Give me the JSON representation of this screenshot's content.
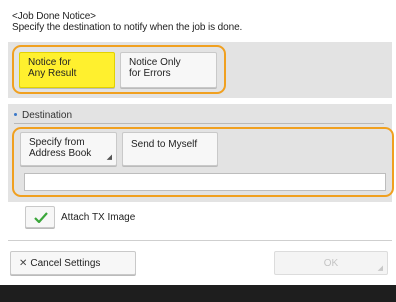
{
  "header": {
    "title": "<Job Done Notice>",
    "description": "Specify the destination to notify when the job is done."
  },
  "notice_options": {
    "any_result_line1": "Notice for",
    "any_result_line2": "Any Result",
    "errors_only_line1": "Notice Only",
    "errors_only_line2": "for Errors",
    "selected": "any_result"
  },
  "destination": {
    "label": "Destination",
    "address_book_line1": "Specify from",
    "address_book_line2": "Address Book",
    "send_to_myself": "Send to Myself",
    "input_value": ""
  },
  "attach": {
    "label": "Attach TX Image",
    "checked": true
  },
  "footer": {
    "cancel_label": "Cancel Settings",
    "ok_label": "OK"
  },
  "colors": {
    "highlight": "#f0a020",
    "selected": "#fff02e",
    "check": "#3aa63a"
  }
}
